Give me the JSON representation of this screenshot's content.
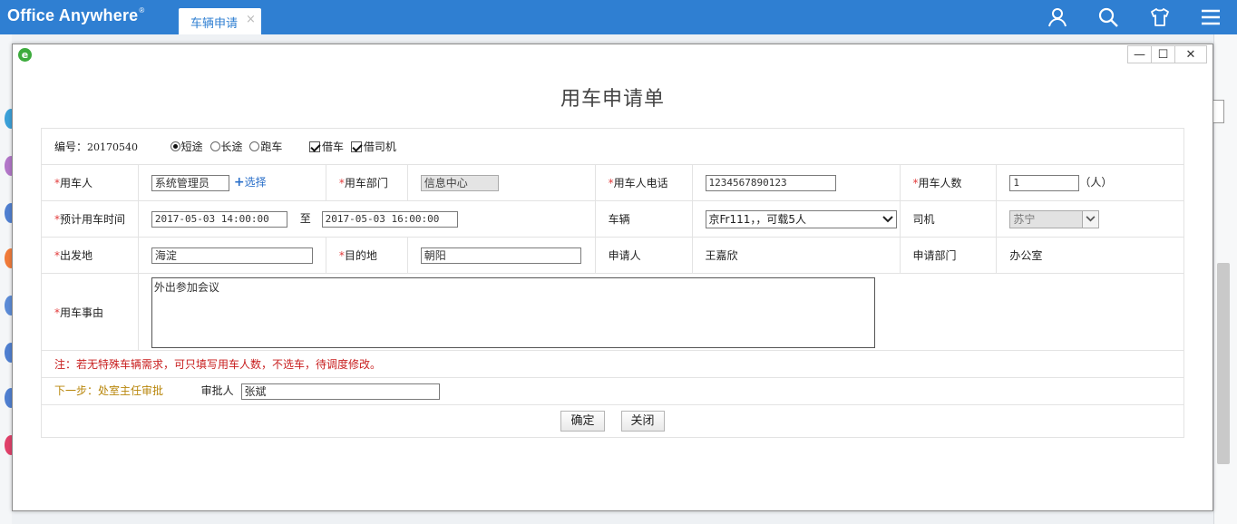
{
  "app": {
    "brand": "Office Anywhere",
    "brand_mark": "®",
    "tab_label": "车辆申请",
    "tab_close": "×",
    "icons": [
      "user-icon",
      "search-icon",
      "shirt-icon",
      "menu-icon"
    ]
  },
  "dialog": {
    "icon_letter": "e",
    "minimize": "—",
    "maximize": "☐",
    "close": "✕"
  },
  "form": {
    "title": "用车申请单",
    "number_label": "编号：",
    "number_value": "20170540",
    "trip_types": [
      {
        "label": "短途",
        "checked": true
      },
      {
        "label": "长途",
        "checked": false
      },
      {
        "label": "跑车",
        "checked": false
      }
    ],
    "borrow_car": {
      "label": "借车",
      "checked": true
    },
    "borrow_driver": {
      "label": "借司机",
      "checked": true
    },
    "required_mark": "*",
    "user_label": "用车人",
    "user_value": "系统管理员",
    "select_link": "选择",
    "dept_label": "用车部门",
    "dept_value": "信息中心",
    "phone_label": "用车人电话",
    "phone_value": "1234567890123",
    "count_label": "用车人数",
    "count_value": "1",
    "count_unit": "（人）",
    "time_label": "预计用车时间",
    "time_start": "2017-05-03 14:00:00",
    "time_to": "至",
    "time_end": "2017-05-03 16:00:00",
    "vehicle_label": "车辆",
    "vehicle_value": "京Fr111，，可载5人",
    "driver_label": "司机",
    "driver_value": "苏宁",
    "origin_label": "出发地",
    "origin_value": "海淀",
    "dest_label": "目的地",
    "dest_value": "朝阳",
    "applicant_label": "申请人",
    "applicant_value": "王嘉欣",
    "applicant_dept_label": "申请部门",
    "applicant_dept_value": "办公室",
    "reason_label": "用车事由",
    "reason_value": "外出参加会议",
    "note": "注：若无特殊车辆需求，可只填写用车人数，不选车，待调度修改。",
    "next_step": "下一步：处室主任审批",
    "approver_label": "审批人",
    "approver_value": "张斌",
    "confirm_button": "确定",
    "close_button": "关闭"
  }
}
